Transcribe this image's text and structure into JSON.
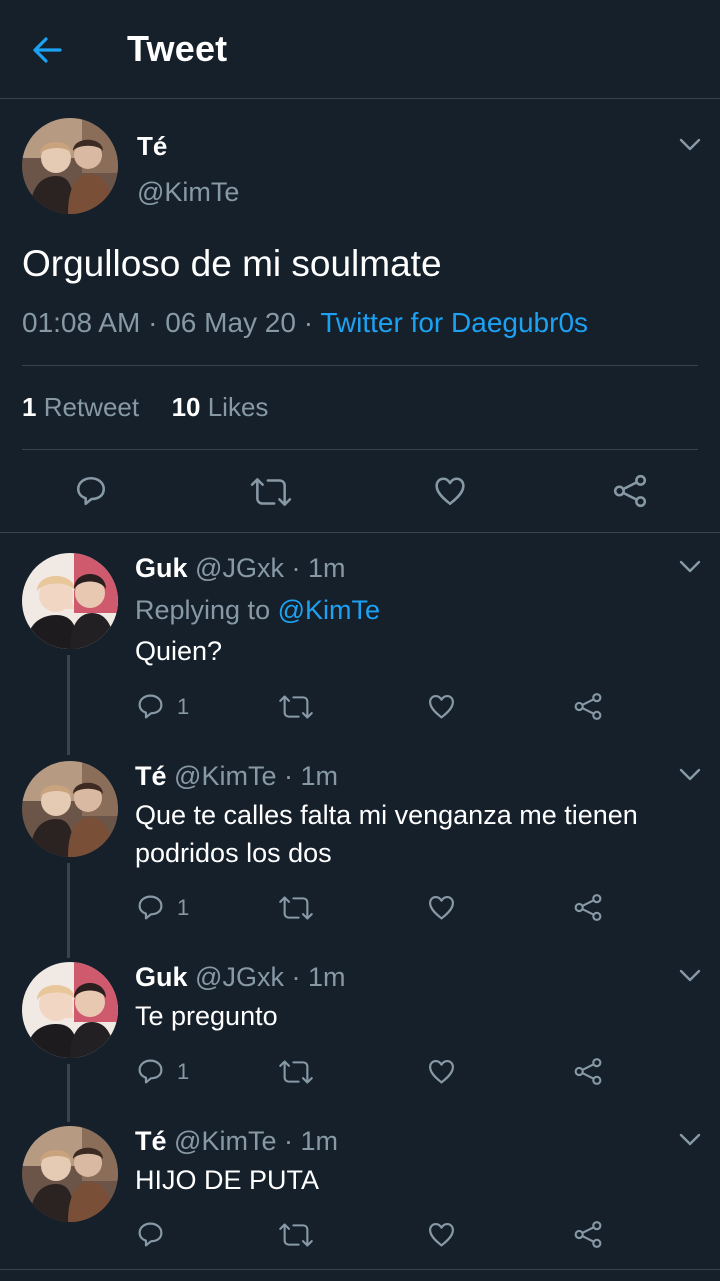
{
  "header": {
    "title": "Tweet"
  },
  "main_tweet": {
    "name": "Té",
    "handle": "@KimTe",
    "text": "Orgulloso de mi soulmate",
    "time": "01:08 AM",
    "sep1": "·",
    "date": "06 May 20",
    "sep2": "·",
    "source": "Twitter for Daegubr0s",
    "retweets_count": "1",
    "retweets_label": "Retweet",
    "likes_count": "10",
    "likes_label": "Likes"
  },
  "replies": [
    {
      "name": "Guk",
      "handle": "@JGxk",
      "dot": "·",
      "time": "1m",
      "replying_prefix": "Replying to ",
      "replying_handle": "@KimTe",
      "text": "Quien?",
      "reply_count": "1"
    },
    {
      "name": "Té",
      "handle": "@KimTe",
      "dot": "·",
      "time": "1m",
      "text": "Que te calles falta mi venganza me tienen podridos los dos",
      "reply_count": "1"
    },
    {
      "name": "Guk",
      "handle": "@JGxk",
      "dot": "·",
      "time": "1m",
      "text": "Te pregunto",
      "reply_count": "1"
    },
    {
      "name": "Té",
      "handle": "@KimTe",
      "dot": "·",
      "time": "1m",
      "text": "HIJO DE PUTA",
      "reply_count": ""
    }
  ],
  "icons": {
    "back": "arrow-left-icon",
    "caret": "chevron-down-icon",
    "reply": "reply-icon",
    "retweet": "retweet-icon",
    "like": "heart-icon",
    "share": "share-icon"
  },
  "colors": {
    "background": "#15202b",
    "accent": "#1da1f2",
    "muted": "#8899a6",
    "divider": "#38444d"
  }
}
